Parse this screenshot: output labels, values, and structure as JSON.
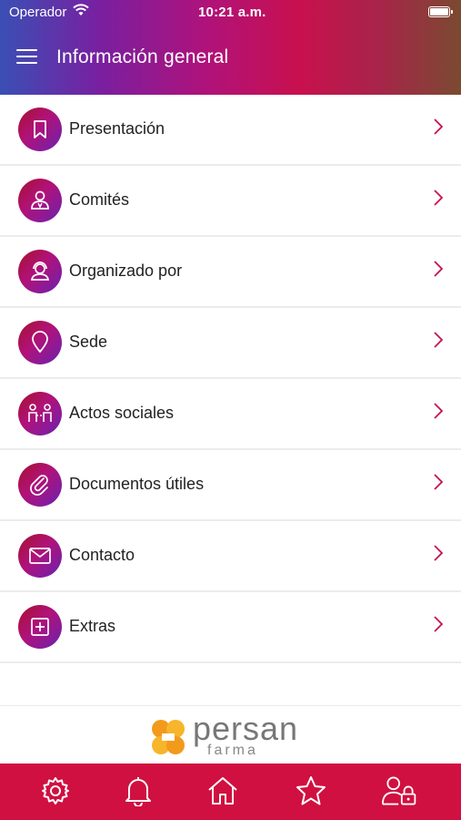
{
  "status_bar": {
    "carrier": "Operador",
    "time": "10:21 a.m."
  },
  "nav": {
    "title": "Información general",
    "menu_icon": "hamburger-icon"
  },
  "menu_items": [
    {
      "label": "Presentación",
      "icon": "bookmark-icon"
    },
    {
      "label": "Comités",
      "icon": "person-icon"
    },
    {
      "label": "Organizado por",
      "icon": "organizer-icon"
    },
    {
      "label": "Sede",
      "icon": "map-pin-icon"
    },
    {
      "label": "Actos sociales",
      "icon": "people-icon"
    },
    {
      "label": "Documentos útiles",
      "icon": "paperclip-icon"
    },
    {
      "label": "Contacto",
      "icon": "envelope-icon"
    },
    {
      "label": "Extras",
      "icon": "plus-square-icon"
    }
  ],
  "brand": {
    "name": "persan",
    "sub": "farma"
  },
  "tabbar": {
    "items": [
      "gear-icon",
      "bell-icon",
      "home-icon",
      "star-icon",
      "user-lock-icon"
    ]
  },
  "colors": {
    "accent": "#d01040",
    "chevron": "#c8104e"
  }
}
